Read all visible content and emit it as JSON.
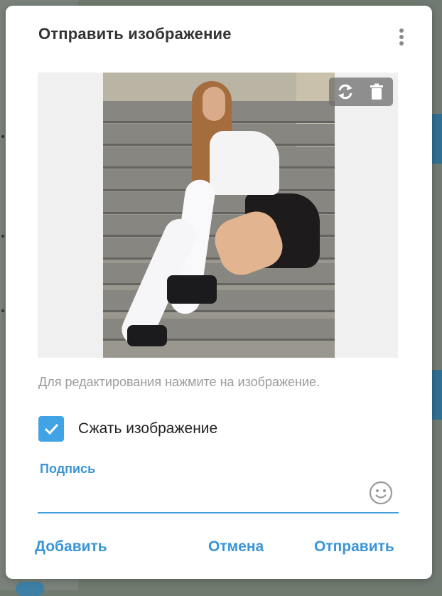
{
  "dialog": {
    "title": "Отправить изображение",
    "menu_icon": "more-vertical-icon",
    "image": {
      "tools": [
        "replace-icon",
        "trash-icon"
      ]
    },
    "hint": "Для редактирования нажмите на изображение.",
    "compress": {
      "label": "Сжать изображение",
      "checked": true
    },
    "caption": {
      "label": "Подпись",
      "value": "",
      "emoji_icon": "smile-icon"
    },
    "buttons": {
      "add": "Добавить",
      "cancel": "Отмена",
      "send": "Отправить"
    }
  },
  "colors": {
    "accent": "#3a95d6",
    "checkbox": "#41a3e6",
    "underline": "#40a0dc",
    "title": "#333333",
    "hint": "#9b9b9b"
  }
}
